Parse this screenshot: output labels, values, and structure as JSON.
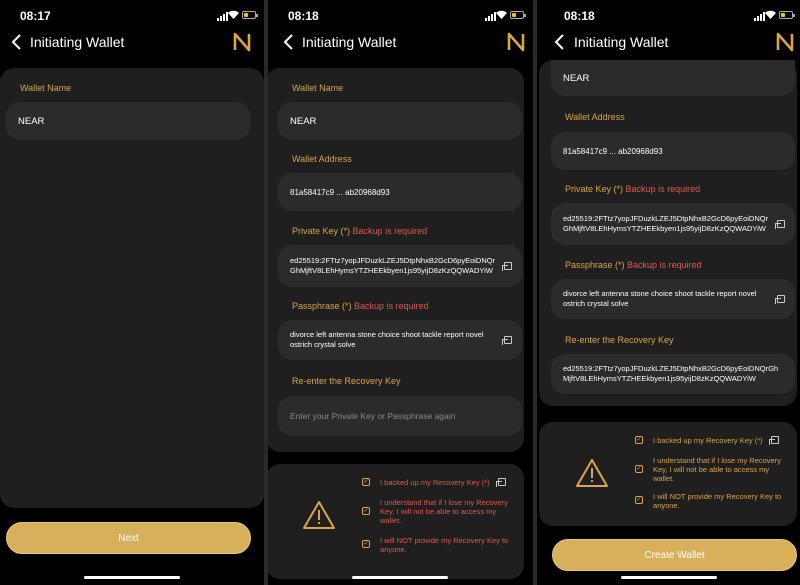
{
  "status": {
    "time_1": "08:17",
    "time_2": "08:18",
    "time_3": "08:18"
  },
  "header": {
    "title": "Initiating Wallet",
    "back_icon": "chevron-left-icon",
    "logo_icon": "near-logo-icon"
  },
  "labels": {
    "wallet_name": "Wallet Name",
    "wallet_address": "Wallet Address",
    "private_key": "Private Key (*)",
    "passphrase": "Passphrase (*)",
    "backup_required": "Backup is required",
    "reenter": "Re-enter the Recovery Key"
  },
  "values": {
    "wallet_name": "NEAR",
    "wallet_address": "81a58417c9 ... ab20968d93",
    "private_key": "ed25519:2FTtz7yopJFDuzkLZEJ5DtpNhxB2GcD6pyEoiDNQrGhMjftV8LEhHymsYTZHEEkbyen1js95yijD8zKzQQWADYiW",
    "passphrase": "divorce left antenna stone choice shoot tackle report novel ostrich crystal solve",
    "reenter_placeholder": "Enter your Private Key or Passphrase again",
    "reenter_value": "ed25519:2FTtz7yopJFDuzkLZEJ5DtpNhxB2GcD6pyEoiDNQrGhMjftV8LEhHymsYTZHEEkbyen1js95yijD8zKzQQWADYiW"
  },
  "checks": {
    "backed_up": "I backed up my Recovery Key (*)",
    "understand": "I understand that if I lose my Recovery Key, I will not be able to access my wallet.",
    "not_provide": "I will NOT provide my Recovery Key to anyone."
  },
  "buttons": {
    "next": "Next",
    "create_wallet": "Create Wallet"
  },
  "colors": {
    "accent": "#d9a44a",
    "required": "#e0584f",
    "button": "#d8b05a",
    "card": "#1f1f1f",
    "field": "#2b2b2b"
  }
}
